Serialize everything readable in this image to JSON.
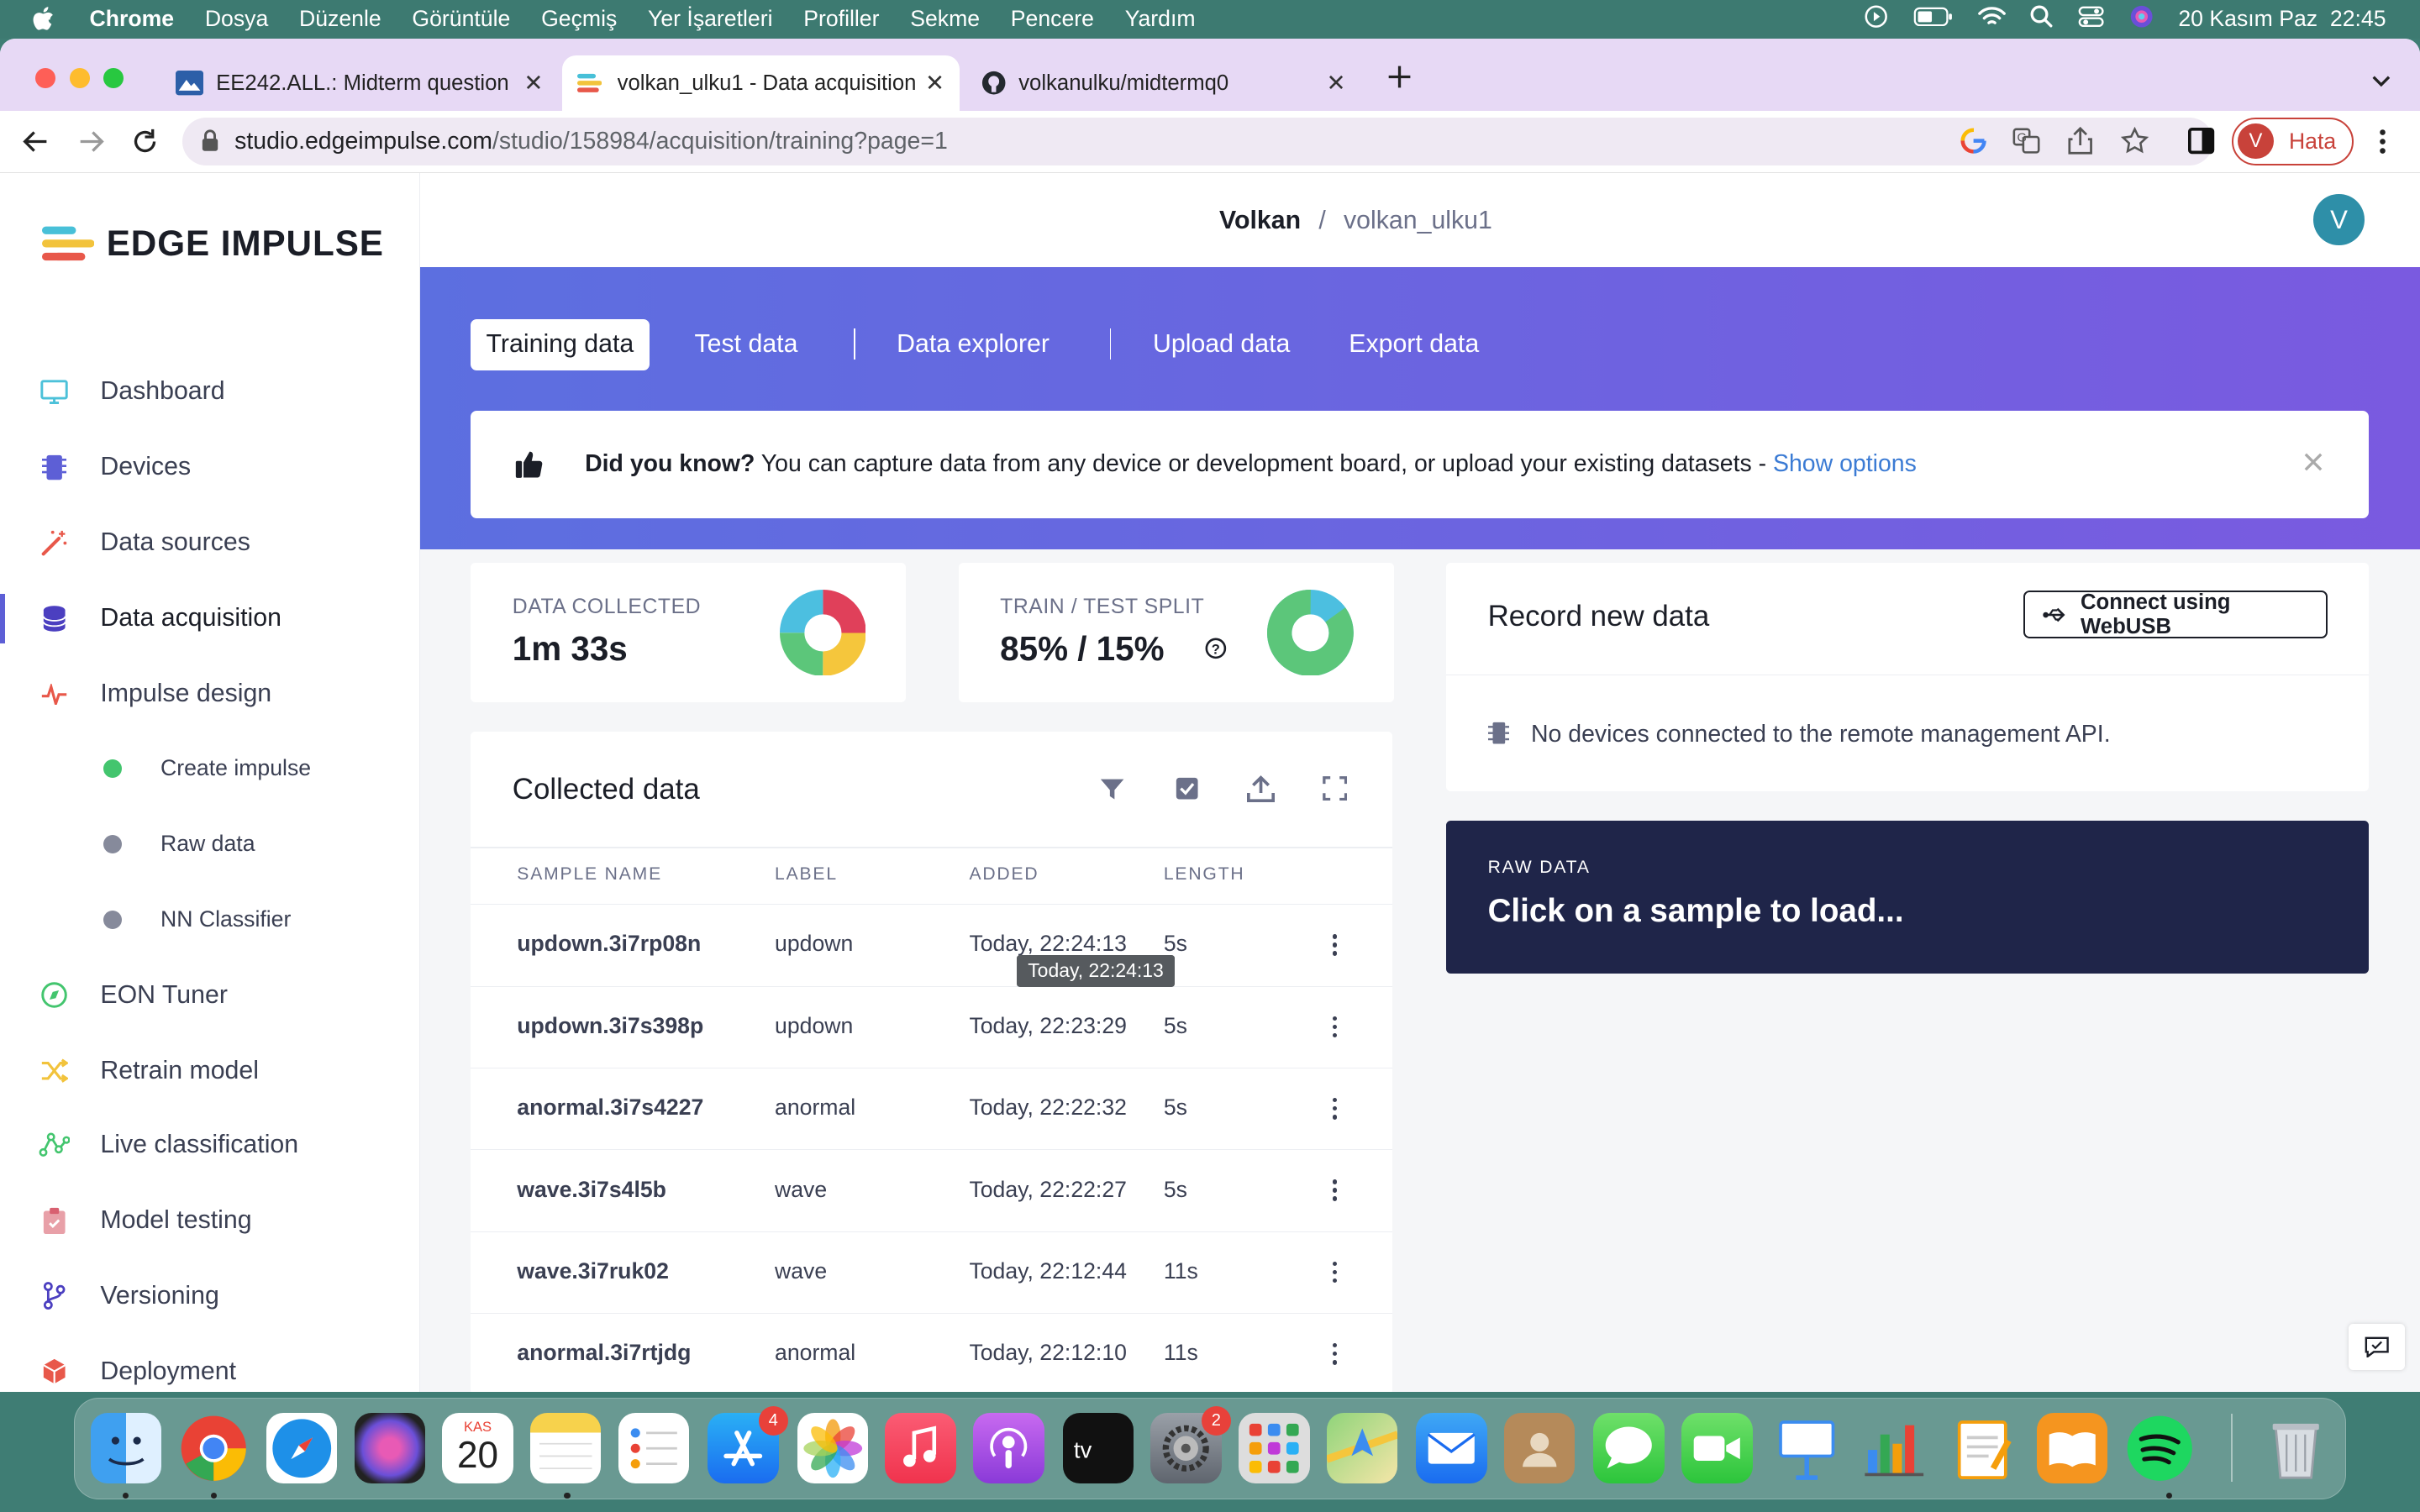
{
  "menubar": {
    "items": [
      "Chrome",
      "Dosya",
      "Düzenle",
      "Görüntüle",
      "Geçmiş",
      "Yer İşaretleri",
      "Profiller",
      "Sekme",
      "Pencere",
      "Yardım"
    ],
    "datetime": "20 Kasım Paz  22:45"
  },
  "browser": {
    "tabs": [
      {
        "title": "EE242.ALL.: Midterm question",
        "icon": "mountain-icon"
      },
      {
        "title": "volkan_ulku1 - Data acquisition",
        "icon": "edge-impulse-icon"
      },
      {
        "title": "volkanulku/midtermq0",
        "icon": "github-icon"
      }
    ],
    "url_host": "studio.edgeimpulse.com",
    "url_path": "/studio/158984/acquisition/training?page=1",
    "profile_initial": "V",
    "profile_label": "Hata"
  },
  "app": {
    "logo_text": "EDGE IMPULSE",
    "breadcrumb_user": "Volkan",
    "breadcrumb_sep": "/",
    "breadcrumb_project": "volkan_ulku1",
    "avatar_initial": "V",
    "nav": [
      {
        "label": "Dashboard",
        "icon": "monitor-icon"
      },
      {
        "label": "Devices",
        "icon": "chip-icon"
      },
      {
        "label": "Data sources",
        "icon": "magic-wand-icon"
      },
      {
        "label": "Data acquisition",
        "icon": "database-icon"
      },
      {
        "label": "Impulse design",
        "icon": "pulse-icon"
      },
      {
        "label": "Create impulse",
        "status": "green"
      },
      {
        "label": "Raw data",
        "status": "grey"
      },
      {
        "label": "NN Classifier",
        "status": "grey"
      },
      {
        "label": "EON Tuner",
        "icon": "compass-icon"
      },
      {
        "label": "Retrain model",
        "icon": "shuffle-icon"
      },
      {
        "label": "Live classification",
        "icon": "network-icon"
      },
      {
        "label": "Model testing",
        "icon": "clipboard-check-icon"
      },
      {
        "label": "Versioning",
        "icon": "git-branch-icon"
      },
      {
        "label": "Deployment",
        "icon": "cube-icon"
      }
    ],
    "tabs": {
      "training": "Training data",
      "test": "Test data",
      "explorer": "Data explorer",
      "upload": "Upload data",
      "export": "Export data"
    },
    "tip": {
      "bold": "Did you know?",
      "text": " You can capture data from any device or development board, or upload your existing datasets - ",
      "link": "Show options"
    },
    "data_collected": {
      "label": "DATA COLLECTED",
      "value": "1m 33s"
    },
    "split": {
      "label": "TRAIN / TEST SPLIT",
      "value": "85% / 15%",
      "train_fraction": 0.85
    },
    "collected": {
      "title": "Collected data",
      "headers": [
        "SAMPLE NAME",
        "LABEL",
        "ADDED",
        "LENGTH"
      ],
      "rows": [
        {
          "name": "updown.3i7rp08n",
          "label": "updown",
          "added": "Today, 22:24:13",
          "length": "5s"
        },
        {
          "name": "updown.3i7s398p",
          "label": "updown",
          "added": "Today, 22:23:29",
          "length": "5s"
        },
        {
          "name": "anormal.3i7s4227",
          "label": "anormal",
          "added": "Today, 22:22:32",
          "length": "5s"
        },
        {
          "name": "wave.3i7s4l5b",
          "label": "wave",
          "added": "Today, 22:22:27",
          "length": "5s"
        },
        {
          "name": "wave.3i7ruk02",
          "label": "wave",
          "added": "Today, 22:12:44",
          "length": "11s"
        },
        {
          "name": "anormal.3i7rtjdg",
          "label": "anormal",
          "added": "Today, 22:12:10",
          "length": "11s"
        }
      ],
      "tooltip": "Today, 22:24:13"
    },
    "record": {
      "title": "Record new data",
      "connect_button": "Connect using WebUSB",
      "no_devices": "No devices connected to the remote management API."
    },
    "raw": {
      "label": "RAW DATA",
      "title": "Click on a sample to load..."
    }
  },
  "dock": {
    "calendar_month": "KAS",
    "calendar_day": "20",
    "appstore_badge": "4",
    "settings_badge": "2"
  },
  "colors": {
    "accent": "#5d5fd6",
    "hero_start": "#5c6fe0",
    "hero_end": "#7a5ae0",
    "raw_panel": "#1f2549",
    "link": "#3b7bd4"
  }
}
